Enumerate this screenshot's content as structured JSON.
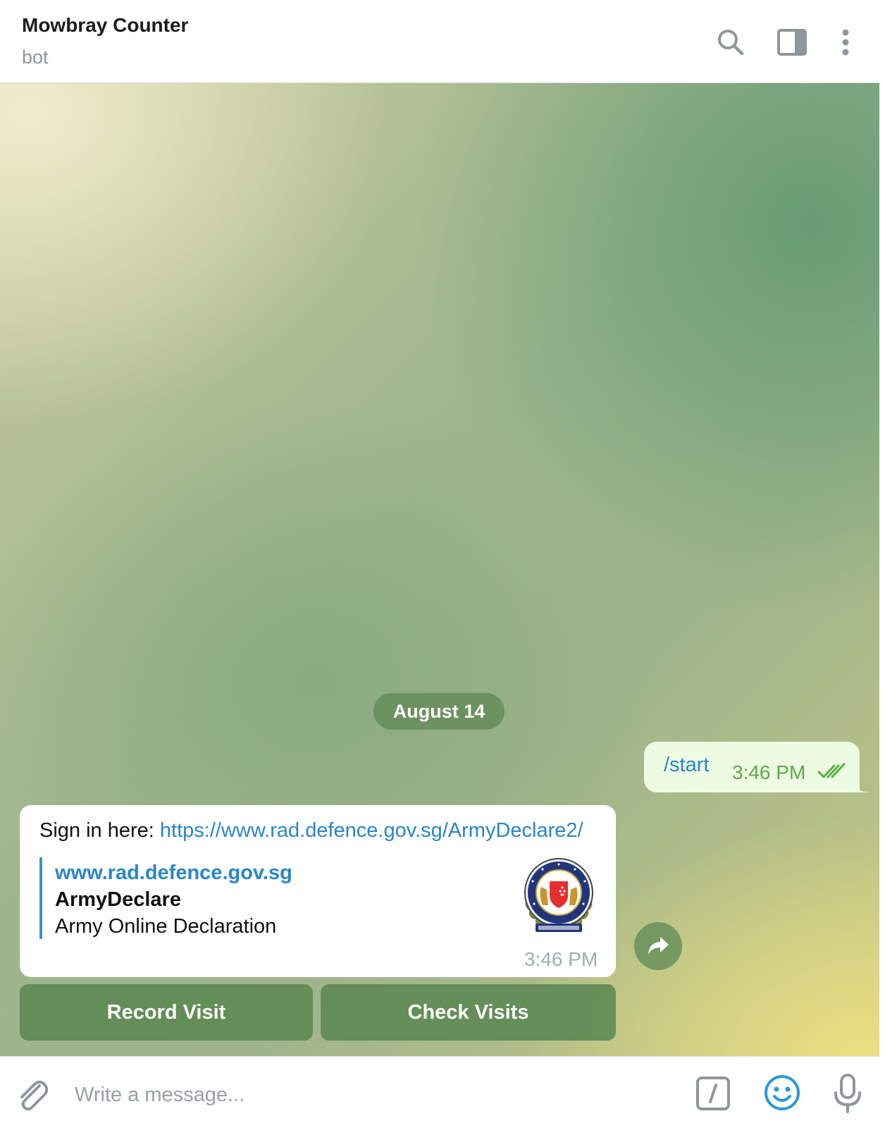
{
  "header": {
    "title": "Mowbray Counter",
    "subtitle": "bot",
    "icons": [
      "search-icon",
      "sidebar-panel-icon",
      "more-vertical-icon"
    ]
  },
  "chat": {
    "date_separator": "August 14",
    "outgoing": {
      "text": "/start",
      "time": "3:46 PM",
      "status_icon": "double-check-icon"
    },
    "incoming": {
      "prefix": "Sign in here: ",
      "link": "https://www.rad.defence.gov.sg/ArmyDeclare2/",
      "preview": {
        "site": "www.rad.defence.gov.sg",
        "title": "ArmyDeclare",
        "description": "Army Online Declaration",
        "thumbnail_icon": "army-crest-icon"
      },
      "time": "3:46 PM"
    },
    "share_icon": "share-arrow-icon",
    "keyboard": {
      "record_label": "Record Visit",
      "check_label": "Check Visits"
    }
  },
  "composer": {
    "placeholder": "Write a message...",
    "icons": [
      "paperclip-icon",
      "bot-command-icon",
      "emoji-icon",
      "microphone-icon"
    ]
  },
  "colors": {
    "link": "#2a86c8",
    "outgoing_bubble": "#eefbe3",
    "read_check": "#5aab45",
    "keyboard_button": "#608a54"
  }
}
